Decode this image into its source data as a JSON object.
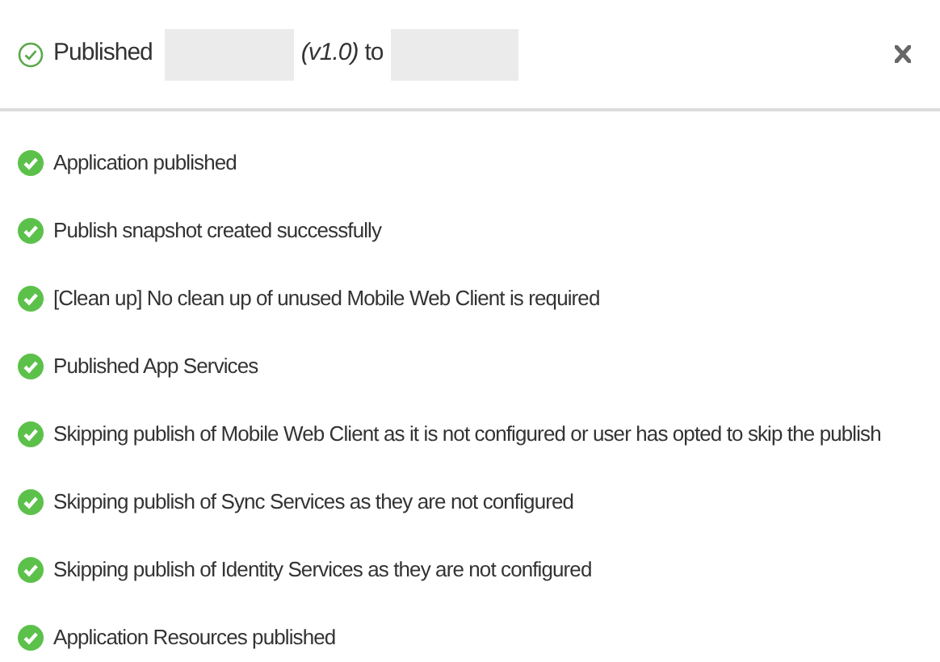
{
  "header": {
    "kind": "success",
    "label": "Published",
    "version": "(v1.0)",
    "connector": "to"
  },
  "messages": [
    {
      "text": "Application published",
      "kind": "success"
    },
    {
      "text": "Publish snapshot created successfully",
      "kind": "success"
    },
    {
      "text": "[Clean up] No clean up of unused Mobile Web Client is required",
      "kind": "success"
    },
    {
      "text": "Published App Services",
      "kind": "success"
    },
    {
      "text": "Skipping publish of Mobile Web Client as it is not configured or user has opted to skip the publish",
      "kind": "success"
    },
    {
      "text": "Skipping publish of Sync Services as they are not configured",
      "kind": "success"
    },
    {
      "text": "Skipping publish of Identity Services as they are not configured",
      "kind": "success"
    },
    {
      "text": "Application Resources published",
      "kind": "success"
    }
  ]
}
